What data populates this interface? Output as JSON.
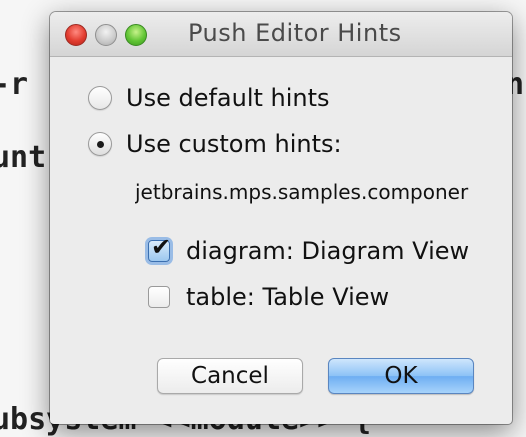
{
  "background_editor": {
    "line1": "-r",
    "line2": "unt",
    "line3": "ubsystem <<module>> {",
    "right1": "n"
  },
  "dialog": {
    "title": "Push Editor Hints",
    "options": {
      "default_hints_label": "Use default hints",
      "default_hints_selected": false,
      "custom_hints_label": "Use custom hints:",
      "custom_hints_selected": true
    },
    "module_name": "jetbrains.mps.samples.componer",
    "hints": [
      {
        "label": "diagram: Diagram View",
        "checked": true
      },
      {
        "label": "table: Table View",
        "checked": false
      }
    ],
    "buttons": {
      "cancel_label": "Cancel",
      "ok_label": "OK"
    }
  },
  "colors": {
    "close": "#e23c2f",
    "minimize": "#c9c9c9",
    "maximize": "#62c535",
    "accent": "#6eaef2"
  }
}
